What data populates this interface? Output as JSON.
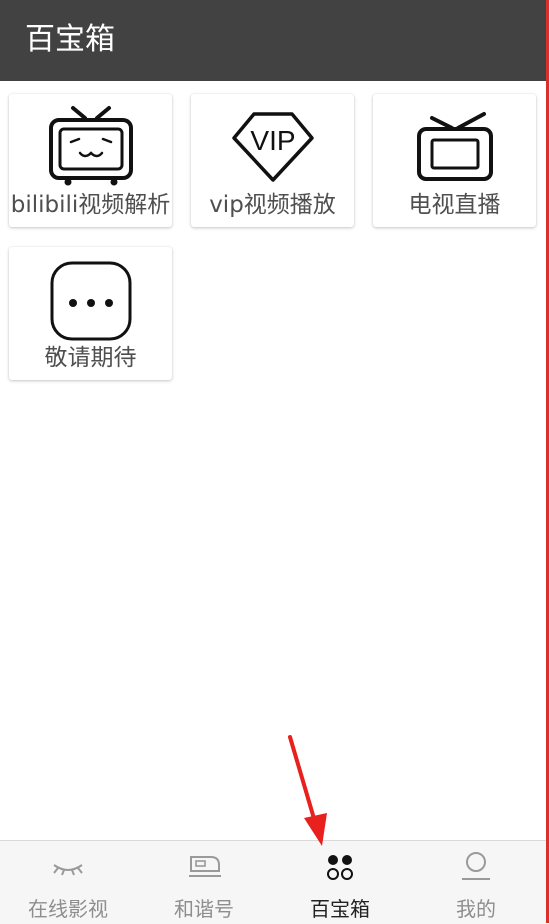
{
  "header": {
    "title": "百宝箱"
  },
  "tools": [
    {
      "label": "bilibili视频解析",
      "icon": "bilibili-tv-icon"
    },
    {
      "label": "vip视频播放",
      "icon": "vip-diamond-icon"
    },
    {
      "label": "电视直播",
      "icon": "tv-icon"
    },
    {
      "label": "敬请期待",
      "icon": "more-dots-icon"
    }
  ],
  "vip_icon_text": "VIP",
  "bottom_nav": [
    {
      "label": "在线影视",
      "icon": "eye-lashes-icon",
      "active": false
    },
    {
      "label": "和谐号",
      "icon": "train-icon",
      "active": false
    },
    {
      "label": "百宝箱",
      "icon": "four-dots-icon",
      "active": true
    },
    {
      "label": "我的",
      "icon": "person-icon",
      "active": false
    }
  ],
  "colors": {
    "header_bg": "#424242",
    "annotation_arrow": "#e8201e"
  }
}
